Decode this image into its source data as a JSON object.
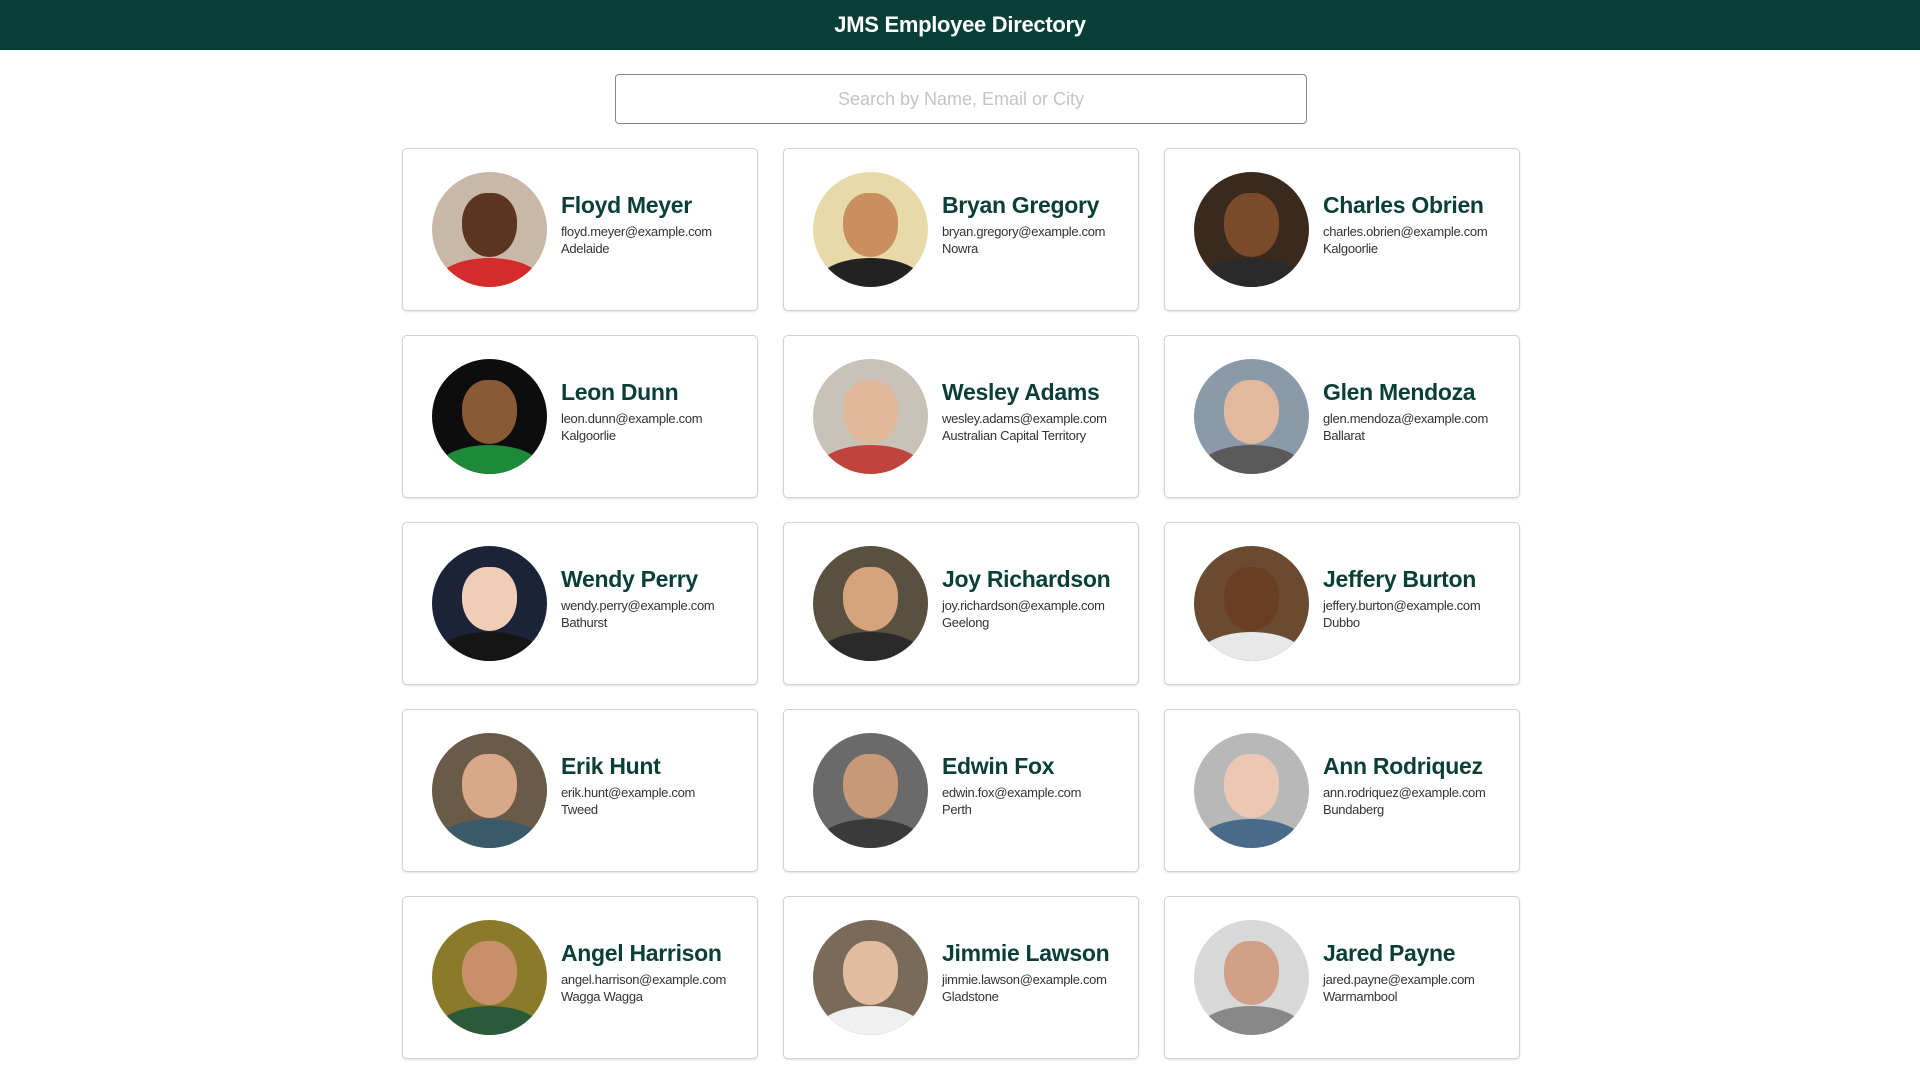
{
  "header": {
    "title": "JMS Employee Directory"
  },
  "search": {
    "placeholder": "Search by Name, Email or City",
    "value": ""
  },
  "employees": [
    {
      "name": "Floyd Meyer",
      "email": "floyd.meyer@example.com",
      "city": "Adelaide",
      "bg": "#c9b8a8",
      "skin": "#5a3520",
      "shirt": "#d42b2b"
    },
    {
      "name": "Bryan Gregory",
      "email": "bryan.gregory@example.com",
      "city": "Nowra",
      "bg": "#e8d9a8",
      "skin": "#c98f5e",
      "shirt": "#222222"
    },
    {
      "name": "Charles Obrien",
      "email": "charles.obrien@example.com",
      "city": "Kalgoorlie",
      "bg": "#3a2a1e",
      "skin": "#7a4a2a",
      "shirt": "#2a2a2a"
    },
    {
      "name": "Leon Dunn",
      "email": "leon.dunn@example.com",
      "city": "Kalgoorlie",
      "bg": "#0d0d0d",
      "skin": "#8a5a36",
      "shirt": "#1d8a3a"
    },
    {
      "name": "Wesley Adams",
      "email": "wesley.adams@example.com",
      "city": "Australian Capital Territory",
      "bg": "#c8c2b8",
      "skin": "#e0b89a",
      "shirt": "#c0443c"
    },
    {
      "name": "Glen Mendoza",
      "email": "glen.mendoza@example.com",
      "city": "Ballarat",
      "bg": "#8a9aa8",
      "skin": "#e2b99c",
      "shirt": "#5a5a5a"
    },
    {
      "name": "Wendy Perry",
      "email": "wendy.perry@example.com",
      "city": "Bathurst",
      "bg": "#1c2238",
      "skin": "#f0cdb8",
      "shirt": "#151515"
    },
    {
      "name": "Joy Richardson",
      "email": "joy.richardson@example.com",
      "city": "Geelong",
      "bg": "#5a5040",
      "skin": "#d6a47c",
      "shirt": "#2a2a2a"
    },
    {
      "name": "Jeffery Burton",
      "email": "jeffery.burton@example.com",
      "city": "Dubbo",
      "bg": "#6a4a30",
      "skin": "#6a3e22",
      "shirt": "#e8e8e8"
    },
    {
      "name": "Erik Hunt",
      "email": "erik.hunt@example.com",
      "city": "Tweed",
      "bg": "#6a5a48",
      "skin": "#d8a888",
      "shirt": "#3a5a6a"
    },
    {
      "name": "Edwin Fox",
      "email": "edwin.fox@example.com",
      "city": "Perth",
      "bg": "#6a6a6a",
      "skin": "#c89878",
      "shirt": "#3a3a3a"
    },
    {
      "name": "Ann Rodriquez",
      "email": "ann.rodriquez@example.com",
      "city": "Bundaberg",
      "bg": "#b8b8b8",
      "skin": "#ecc8b4",
      "shirt": "#4a6a8a"
    },
    {
      "name": "Angel Harrison",
      "email": "angel.harrison@example.com",
      "city": "Wagga Wagga",
      "bg": "#8a7a2a",
      "skin": "#c89068",
      "shirt": "#2a5a3a"
    },
    {
      "name": "Jimmie Lawson",
      "email": "jimmie.lawson@example.com",
      "city": "Gladstone",
      "bg": "#7a6a5a",
      "skin": "#e2bca0",
      "shirt": "#f0f0f0"
    },
    {
      "name": "Jared Payne",
      "email": "jared.payne@example.com",
      "city": "Warrnambool",
      "bg": "#d8d8d8",
      "skin": "#d0a088",
      "shirt": "#888888"
    }
  ]
}
